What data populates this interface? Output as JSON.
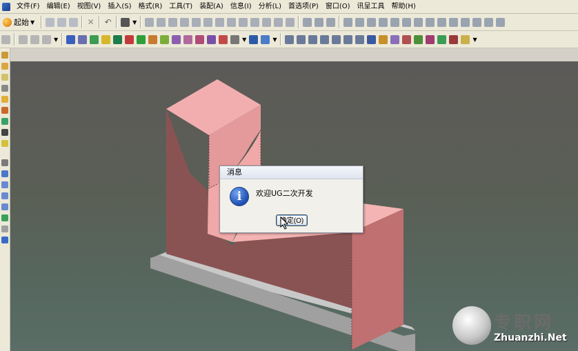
{
  "menu": [
    "文件(F)",
    "编辑(E)",
    "视图(V)",
    "插入(S)",
    "格式(R)",
    "工具(T)",
    "装配(A)",
    "信息(I)",
    "分析(L)",
    "首选项(P)",
    "窗口(O)",
    "讯呈工具",
    "帮助(H)"
  ],
  "toolbar": {
    "start_label": "起始"
  },
  "dialog": {
    "title": "消息",
    "icon": "info-icon",
    "message": "欢迎UG二次开发",
    "ok_label": "确定(O)"
  },
  "watermark": {
    "cn": "专职网",
    "en": "Zhuanzhi.Net"
  },
  "colors": {
    "model_light": "#f2aeae",
    "model_mid": "#c07070",
    "model_dark": "#8a5353",
    "base": "#b0b0b0"
  }
}
